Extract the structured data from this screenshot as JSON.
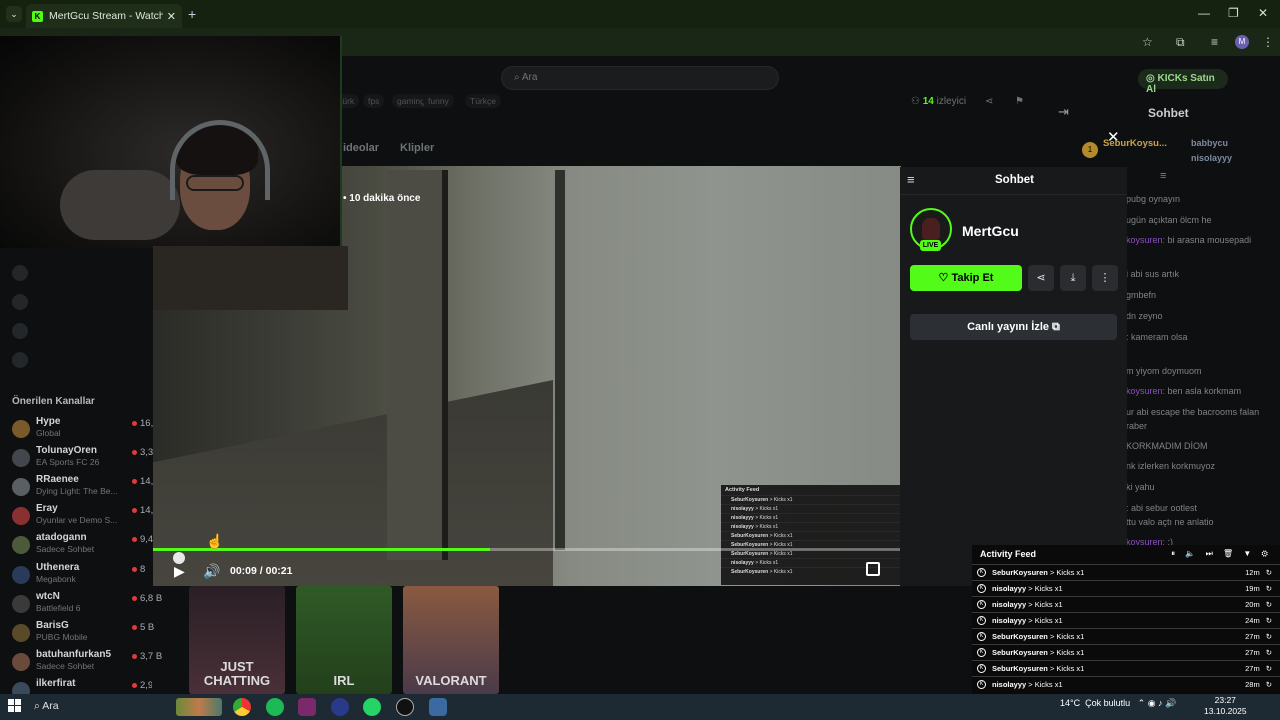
{
  "browser": {
    "tab_title": "MertGcu Stream - Watch Live o",
    "new_tab": "+",
    "tab_list": "⌄",
    "window_controls": {
      "minimize": "—",
      "restore": "❐",
      "close": "✕"
    },
    "profile_initial": "M",
    "toolbar_icons": {
      "star": "☆",
      "extensions": "⧉",
      "media": "≡",
      "menu": "⋮"
    }
  },
  "kick": {
    "search_placeholder": "Ara",
    "buy_kicks": "KICKs Satın Al",
    "tags": [
      "türk",
      "fps",
      "gaming",
      "funny",
      "Türkçe"
    ],
    "viewer_count": "14",
    "viewer_label": "izleyici",
    "nav_tabs": [
      "ideolar",
      "Klipler"
    ],
    "top_chat_title": "Sohbet",
    "close": "✕",
    "stream_time_ago": "10 dakika önce"
  },
  "video": {
    "current_time": "00:09 / 00:21",
    "progress": 0.45,
    "play_icon": "▶",
    "volume_icon": "🔊"
  },
  "video_overlay_feed": {
    "title": "Activity Feed",
    "rows": [
      {
        "who": "SeburKoysuren",
        "what": "> Kicks x1"
      },
      {
        "who": "nisolayyy",
        "what": "> Kicks x1"
      },
      {
        "who": "nisolayyy",
        "what": "> Kicks x1"
      },
      {
        "who": "nisolayyy",
        "what": "> Kicks x1"
      },
      {
        "who": "SeburKoysuren",
        "what": "> Kicks x1"
      },
      {
        "who": "SeburKoysuren",
        "what": "> Kicks x1"
      },
      {
        "who": "SeburKoysuren",
        "what": "> Kicks x1"
      },
      {
        "who": "nisolayyy",
        "what": "> Kicks x1"
      },
      {
        "who": "SeburKoysuren",
        "what": "> Kicks x1"
      }
    ]
  },
  "sidebar": {
    "recommended_title": "Önerilen Kanallar",
    "channels": [
      {
        "name": "Hype",
        "game": "Global",
        "viewers": "16,6"
      },
      {
        "name": "TolunayOren",
        "game": "EA Sports FC 26",
        "viewers": "3,3"
      },
      {
        "name": "RRaenee",
        "game": "Dying Light: The Be...",
        "viewers": "14,8"
      },
      {
        "name": "Eray",
        "game": "Oyunlar ve Demo S...",
        "viewers": "14,7"
      },
      {
        "name": "atadogann",
        "game": "Sadece Sohbet",
        "viewers": "9,4"
      },
      {
        "name": "Uthenera",
        "game": "Megabonk",
        "viewers": "8"
      },
      {
        "name": "wtcN",
        "game": "Battlefield 6",
        "viewers": "6,8 B"
      },
      {
        "name": "BarisG",
        "game": "PUBG Mobile",
        "viewers": "5 B"
      },
      {
        "name": "batuhanfurkan5",
        "game": "Sadece Sohbet",
        "viewers": "3,7 B"
      },
      {
        "name": "ilkerfirat",
        "game": "",
        "viewers": "2,9 B"
      }
    ]
  },
  "categories": [
    {
      "label": "JUST\nCHATTING",
      "color": "#3b2a30"
    },
    {
      "label": "IRL",
      "color": "#33492a"
    },
    {
      "label": "VALORANT",
      "color": "#6b4a3a"
    }
  ],
  "chat_bg": {
    "leaderboard": [
      {
        "rank": "1",
        "name": "SeburKoysu..."
      },
      {
        "name": "babbycu",
        "n": "1"
      },
      {
        "name": "nisolayyy",
        "n": "1"
      }
    ],
    "lines": [
      {
        "text": "pubg oynayın"
      },
      {
        "text": "ugün açıktan ölcm he"
      },
      {
        "user": "koysuren:",
        "text": "bi arasna mousepadi"
      },
      {
        "text": "i abi sus artık"
      },
      {
        "text": "gmbefn"
      },
      {
        "text": "dn zeyno"
      },
      {
        "user": "",
        "text": ": kameram olsa"
      },
      {
        "text": "m yiyom doymuom"
      },
      {
        "user": "koysuren:",
        "text": "ben asla korkmam"
      },
      {
        "text": "ur abi escape the bacrooms falan"
      },
      {
        "text": "raber"
      },
      {
        "text": "KORKMADIM DİOM"
      },
      {
        "text": "nk izlerken korkmuyoz"
      },
      {
        "text": "ki yahu"
      },
      {
        "text": ": abi sebur ootlest"
      },
      {
        "text": "ttu valo açtı ne anlatio"
      },
      {
        "user": "koysuren:",
        "text": ":)"
      }
    ]
  },
  "creator_panel": {
    "header": "Sohbet",
    "name": "MertGcu",
    "live_badge": "LIVE",
    "follow_label": "Takip Et",
    "follow_icon": "♡",
    "share_icon": "⋖",
    "download_icon": "⤓",
    "more_icon": "⋮",
    "watch_live": "Canlı yayını İzle",
    "menu_icon": "≡"
  },
  "activity_feed": {
    "title": "Activity Feed",
    "controls": "⏸ 🔈 ⏭ 🗑 ▼ ⚙",
    "rows": [
      {
        "who": "SeburKoysuren",
        "what": "> Kicks x1",
        "time": "12m"
      },
      {
        "who": "nisolayyy",
        "what": "> Kicks x1",
        "time": "19m"
      },
      {
        "who": "nisolayyy",
        "what": "> Kicks x1",
        "time": "20m"
      },
      {
        "who": "nisolayyy",
        "what": "> Kicks x1",
        "time": "24m"
      },
      {
        "who": "SeburKoysuren",
        "what": "> Kicks x1",
        "time": "27m"
      },
      {
        "who": "SeburKoysuren",
        "what": "> Kicks x1",
        "time": "27m"
      },
      {
        "who": "SeburKoysuren",
        "what": "> Kicks x1",
        "time": "27m"
      },
      {
        "who": "nisolayyy",
        "what": "> Kicks x1",
        "time": "28m"
      },
      {
        "who": "SeburKoysuren",
        "what": "> Kicks x1",
        "time": "28m"
      },
      {
        "who": "nisolayyy",
        "what": "> Kicks x1",
        "time": "28m"
      }
    ]
  },
  "taskbar": {
    "search": "Ara",
    "weather": "14°C",
    "weather_desc": "Çok bulutlu",
    "time": "23:27",
    "date": "13.10.2025"
  }
}
